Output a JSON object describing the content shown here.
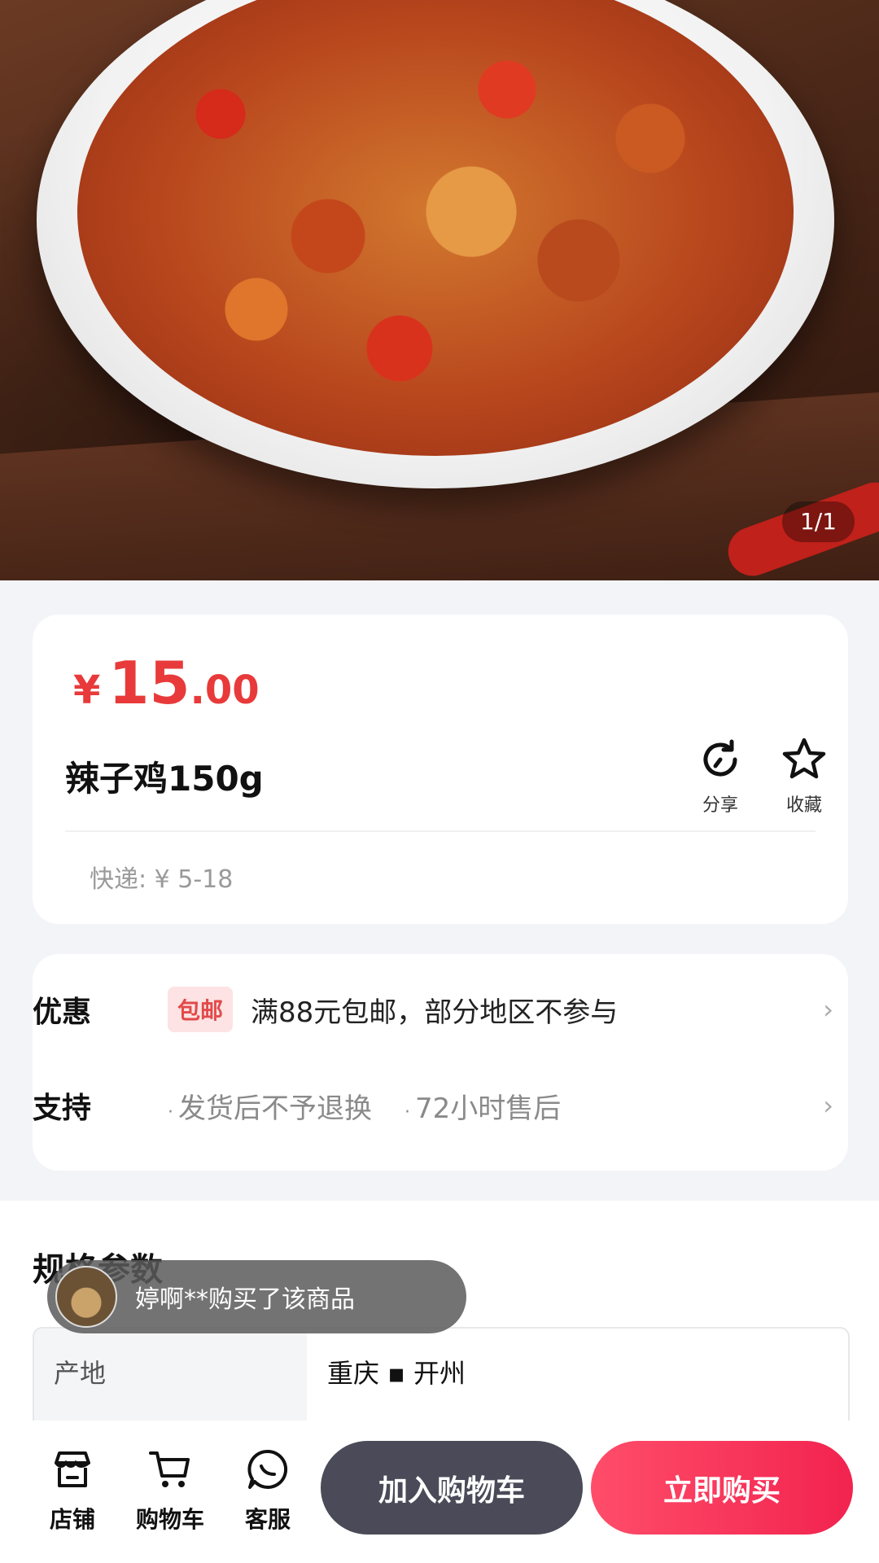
{
  "gallery": {
    "counter": "1/1"
  },
  "price": {
    "currency": "¥",
    "integer": "15",
    "decimal": ".00"
  },
  "product": {
    "title": "辣子鸡150g"
  },
  "actions": {
    "share": "分享",
    "favorite": "收藏"
  },
  "shipping": {
    "text": "快递: ¥ 5-18"
  },
  "promotion": {
    "label": "优惠",
    "tag": "包邮",
    "text": "满88元包邮，部分地区不参与"
  },
  "support": {
    "label": "支持",
    "items": [
      "发货后不予退换",
      "72小时售后"
    ]
  },
  "specs": {
    "title": "规格参数",
    "rows": [
      {
        "key": "产地",
        "value": "重庆 ▪ 开州"
      }
    ]
  },
  "toast": {
    "message": "婷啊**购买了该商品"
  },
  "bottom_nav": {
    "shop": "店铺",
    "cart": "购物车",
    "service": "客服",
    "add_to_cart": "加入购物车",
    "buy_now": "立即购买"
  },
  "colors": {
    "price": "#e83a3a",
    "buy": "#f2234f",
    "add_cart": "#4a4a58"
  },
  "icons": {
    "share": "share-icon",
    "favorite": "star-icon",
    "shop": "store-icon",
    "cart": "cart-icon",
    "service": "chat-icon",
    "chevron": "chevron-right-icon"
  }
}
